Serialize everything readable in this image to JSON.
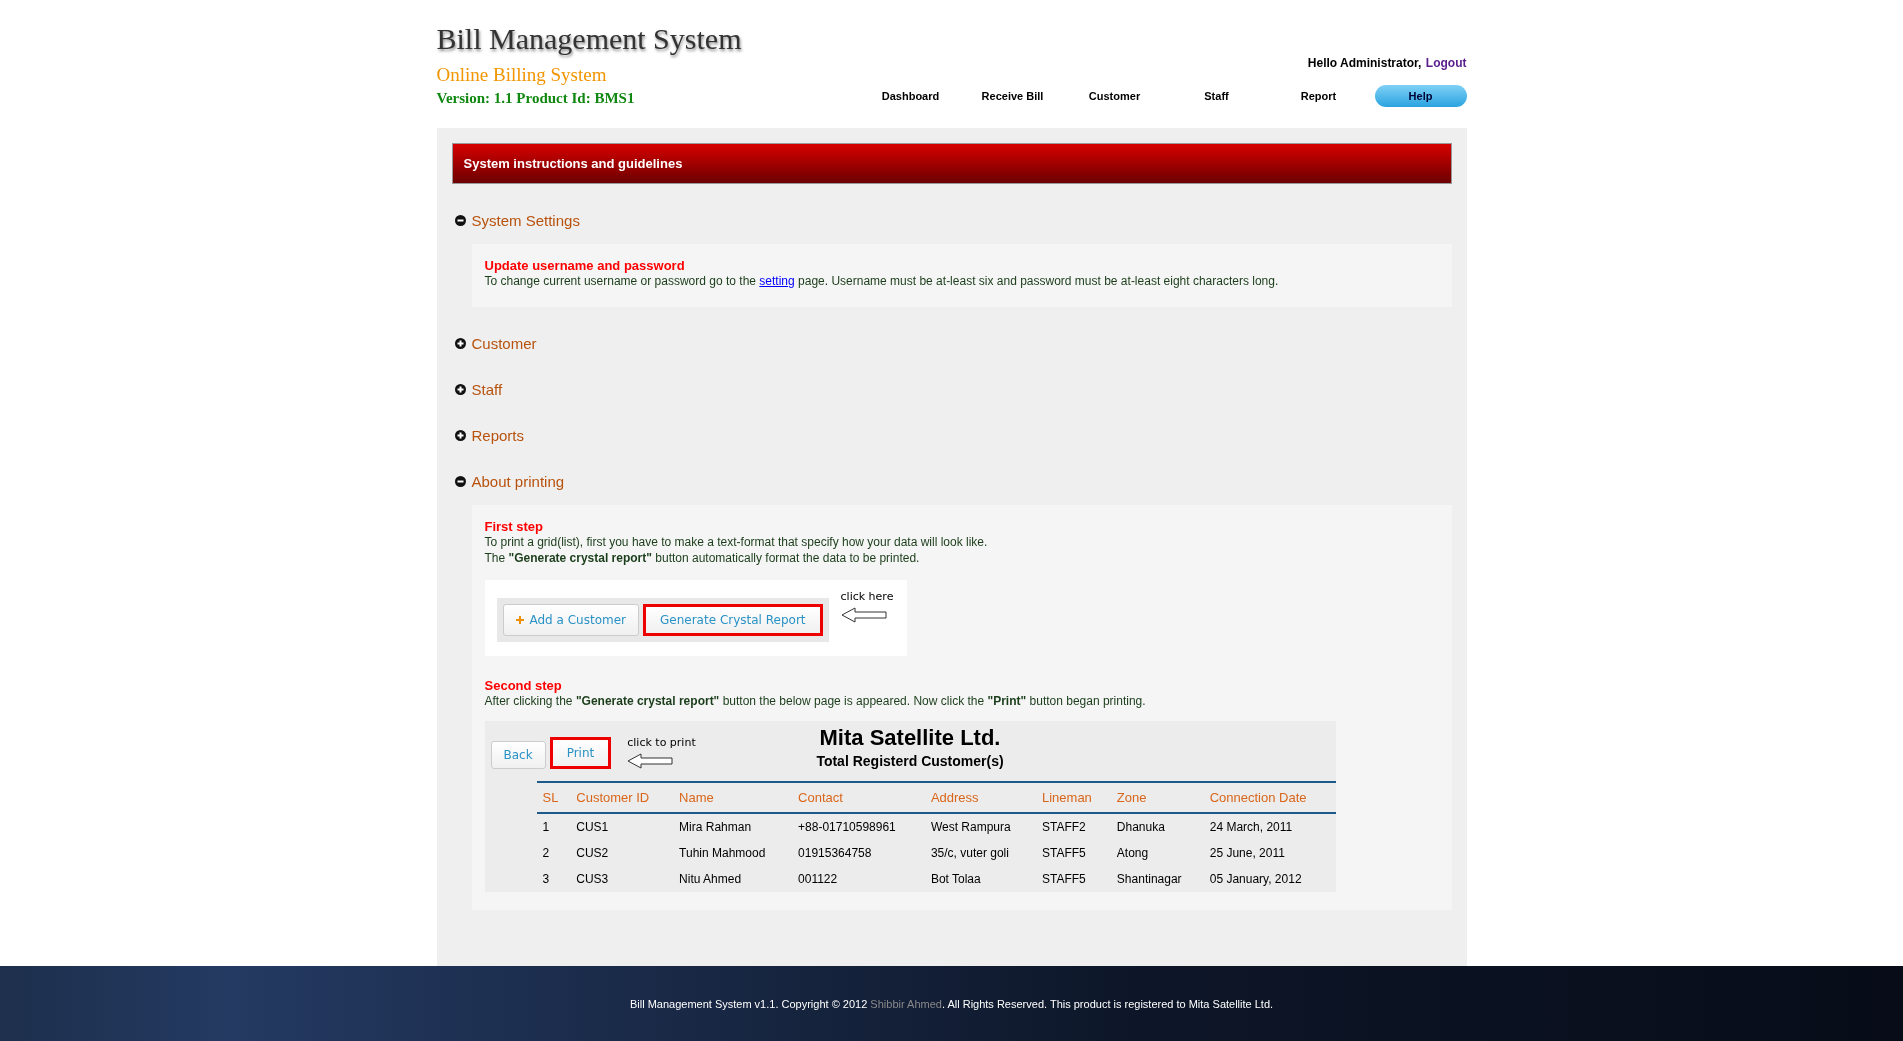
{
  "header": {
    "title": "Bill Management System",
    "subtitle": "Online Billing System",
    "version": "Version: 1.1 Product Id: BMS1",
    "greeting": "Hello Administrator,",
    "logout": "Logout"
  },
  "nav": [
    {
      "label": "Dashboard",
      "selected": false
    },
    {
      "label": "Receive Bill",
      "selected": false
    },
    {
      "label": "Customer",
      "selected": false
    },
    {
      "label": "Staff",
      "selected": false
    },
    {
      "label": "Report",
      "selected": false
    },
    {
      "label": "Help",
      "selected": true
    }
  ],
  "banner": "System instructions and guidelines",
  "sections": [
    {
      "title": "System Settings",
      "expanded": true,
      "blocks": [
        {
          "kind": "heading",
          "text": "Update username and password"
        },
        {
          "kind": "link_paragraph",
          "before": "To change current username or password go to the",
          "link": "setting",
          "after": "page. Username must be at-least six and password must be at-least eight characters long."
        }
      ]
    },
    {
      "title": "Customer",
      "expanded": false
    },
    {
      "title": "Staff",
      "expanded": false
    },
    {
      "title": "Reports",
      "expanded": false
    },
    {
      "title": "About printing",
      "expanded": true,
      "blocks": [
        {
          "kind": "heading",
          "text": "First step"
        },
        {
          "kind": "paragraph",
          "lines": [
            "To print a grid(list), first you have to make a text-format that specify how your data will look like.",
            "The **\"Generate crystal report\"** button automatically format the data to be printed."
          ]
        },
        {
          "kind": "demo_buttons",
          "note": "click here",
          "buttons": [
            {
              "label": "Add a Customer",
              "kind": "add",
              "highlighted": false
            },
            {
              "label": "Generate Crystal Report",
              "kind": "plain",
              "highlighted": true
            }
          ]
        },
        {
          "kind": "heading",
          "text": "Second step"
        },
        {
          "kind": "paragraph",
          "lines": [
            "After clicking the **\"Generate crystal report\"** button the below page is appeared. Now click the **\"Print\"** button began printing."
          ]
        },
        {
          "kind": "demo_report",
          "title": "Mita Satellite Ltd.",
          "subtitle": "Total Registerd Customer(s)",
          "note": "click to print",
          "buttons": [
            {
              "label": "Back",
              "kind": "plain",
              "highlighted": false
            },
            {
              "label": "Print",
              "kind": "plain",
              "highlighted": true
            }
          ],
          "table": {
            "columns": [
              "SL",
              "Customer ID",
              "Name",
              "Contact",
              "Address",
              "Lineman",
              "Zone",
              "Connection Date"
            ],
            "rows": [
              [
                "1",
                "CUS1",
                "Mira Rahman",
                "+88-01710598961",
                "West Rampura",
                "STAFF2",
                "Dhanuka",
                "24 March, 2011"
              ],
              [
                "2",
                "CUS2",
                "Tuhin Mahmood",
                "01915364758",
                "35/c, vuter goli",
                "STAFF5",
                "Atong",
                "25 June, 2011"
              ],
              [
                "3",
                "CUS3",
                "Nitu Ahmed",
                "001122",
                "Bot Tolaa",
                "STAFF5",
                "Shantinagar",
                "05 January, 2012"
              ]
            ]
          }
        }
      ]
    }
  ],
  "footer": {
    "before": "Bill Management System v1.1. Copyright © 2012",
    "author": "Shibbir Ahmed",
    "after": ". All Rights Reserved. This product is registered to Mita Satellite Ltd."
  }
}
